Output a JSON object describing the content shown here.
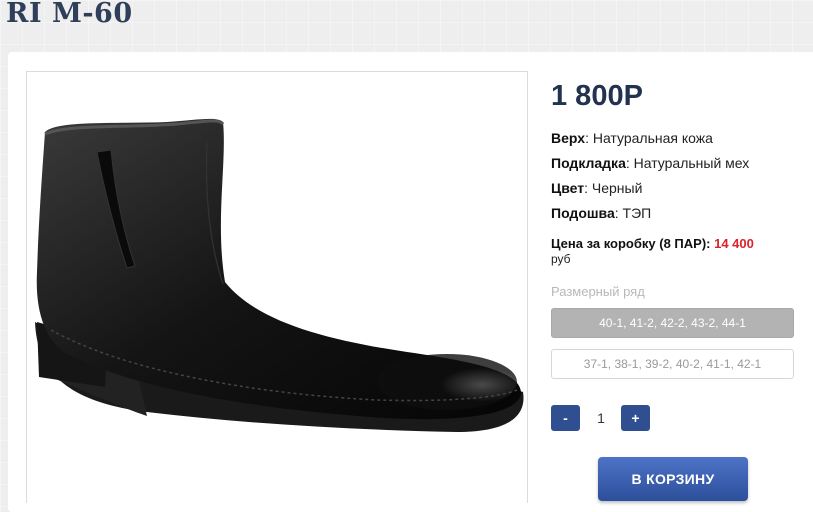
{
  "product": {
    "title": "RI M-60",
    "price": "1 800Р",
    "specs": [
      {
        "label": "Верх",
        "value": ": Натуральная кожа"
      },
      {
        "label": "Подкладка",
        "value": ": Натуральный мех"
      },
      {
        "label": "Цвет",
        "value": ": Черный"
      },
      {
        "label": "Подошва",
        "value": ": ТЭП"
      }
    ],
    "box_price_label": "Цена за коробку (8 ПАР): ",
    "box_price_value": "14 400",
    "box_price_unit": "руб",
    "image_icon": "black-leather-ankle-boot"
  },
  "sizes": {
    "label": "Размерный ряд",
    "options": [
      {
        "text": "40-1, 41-2, 42-2, 43-2, 44-1",
        "selected": true
      },
      {
        "text": "37-1, 38-1, 39-2, 40-2, 41-1, 42-1",
        "selected": false
      }
    ]
  },
  "quantity": {
    "minus_label": "-",
    "value": "1",
    "plus_label": "+"
  },
  "cart": {
    "button_label": "В КОРЗИНУ"
  },
  "colors": {
    "accent": "#2f4f91",
    "price_text": "#22324f",
    "box_price_red": "#d8232a"
  }
}
